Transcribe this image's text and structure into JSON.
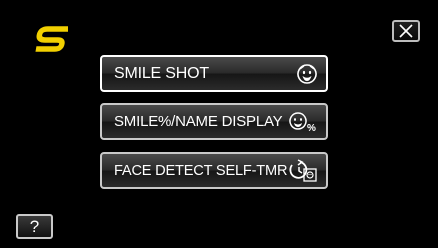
{
  "menu": {
    "items": [
      {
        "label": "SMILE SHOT",
        "icon": "smile-face-icon"
      },
      {
        "label": "SMILE%/NAME DISPLAY",
        "icon": "smile-percent-icon"
      },
      {
        "label": "FACE DETECT SELF-TMR",
        "icon": "face-timer-icon"
      }
    ]
  },
  "help": {
    "label": "?"
  },
  "close": {
    "icon": "close-icon"
  },
  "logo": {
    "icon": "smile-mode-logo-icon",
    "color": "#f2d000"
  },
  "colors": {
    "background": "#000000",
    "button_border": "#c9c9c9",
    "accent": "#f2d000"
  }
}
